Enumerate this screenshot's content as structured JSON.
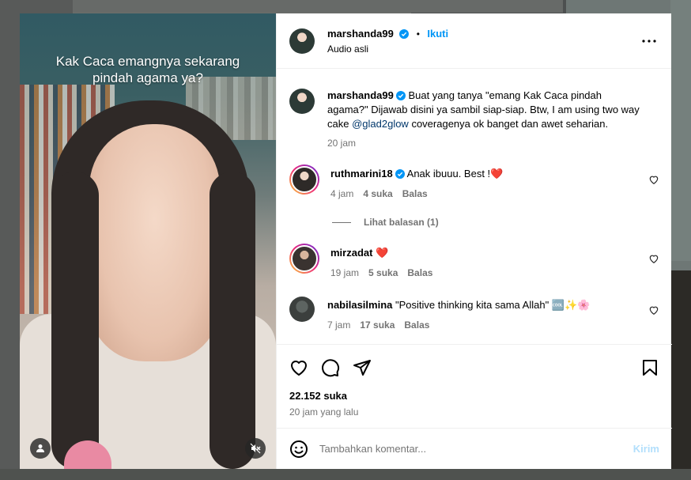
{
  "media": {
    "caption": "Kak Caca emangnya sekarang\npindah agama ya?"
  },
  "post": {
    "username": "marshanda99",
    "follow_label": "Ikuti",
    "audio_label": "Audio asli"
  },
  "caption_comment": {
    "username": "marshanda99",
    "text_before": " Buat yang tanya \"emang Kak Caca pindah agama?\" Dijawab disini ya sambil siap-siap. Btw, I am using two way cake ",
    "mention": "@glad2glow",
    "text_after": " coveragenya ok banget dan awet seharian.",
    "time": "20 jam"
  },
  "comments": [
    {
      "username": "ruthmarini18",
      "text": " Anak ibuuu. Best !❤️",
      "time": "4 jam",
      "likes": "4 suka",
      "reply": "Balas"
    },
    {
      "username": "mirzadat",
      "text": " ❤️",
      "time": "19 jam",
      "likes": "5 suka",
      "reply": "Balas"
    },
    {
      "username": "nabilasilmina",
      "text": " \"Positive thinking kita sama Allah\" 🆒✨🌸",
      "time": "7 jam",
      "likes": "17 suka",
      "reply": "Balas"
    }
  ],
  "view_replies": "Lihat balasan (1)",
  "likes_count": "22.152 suka",
  "posted_time": "20 jam yang lalu",
  "add_comment": {
    "placeholder": "Tambahkan komentar...",
    "send_label": "Kirim"
  },
  "colors": {
    "accent": "#0095f6",
    "send_disabled": "#b2dffc",
    "muted": "#737373"
  },
  "icons": [
    "more-icon",
    "verified-icon",
    "like-icon",
    "comment-icon",
    "share-icon",
    "save-icon",
    "emoji-icon",
    "user-icon",
    "mute-icon",
    "heart-icon"
  ]
}
